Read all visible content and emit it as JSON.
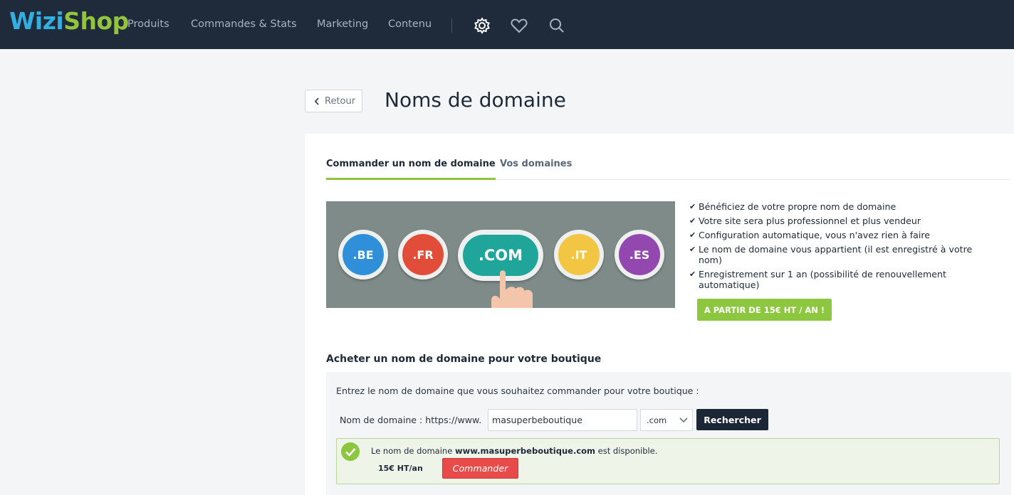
{
  "brand": {
    "part1": "Wizi",
    "part2": "Shop"
  },
  "nav": {
    "items": [
      "Produits",
      "Commandes & Stats",
      "Marketing",
      "Contenu"
    ],
    "icons": [
      "gear-icon",
      "heart-icon",
      "search-icon"
    ]
  },
  "header": {
    "back_label": "Retour",
    "title": "Noms de domaine"
  },
  "tabs": [
    {
      "label": "Commander un nom de domaine",
      "active": true
    },
    {
      "label": "Vos domaines",
      "active": false
    }
  ],
  "banner": {
    "extensions": [
      {
        "label": ".BE",
        "color": "#2f8fd8"
      },
      {
        "label": ".FR",
        "color": "#e24d3a"
      },
      {
        "label": ".COM",
        "color": "#1fa59a"
      },
      {
        "label": ".IT",
        "color": "#f2c542"
      },
      {
        "label": ".ES",
        "color": "#9348b0"
      }
    ]
  },
  "features": [
    "Bénéficiez de votre propre nom de domaine",
    "Votre site sera plus professionnel et plus vendeur",
    "Configuration automatique, vous n'avez rien à faire",
    "Le nom de domaine vous appartient (il est enregistré à votre nom)",
    "Enregistrement sur 1 an (possibilité de renouvellement automatique)"
  ],
  "cta_label": "A PARTIR DE 15€ HT / AN !",
  "buy": {
    "section_title": "Acheter un nom de domaine pour votre boutique",
    "intro": "Entrez le nom de domaine que vous souhaitez commander pour votre boutique :",
    "field_label": "Nom de domaine : https://www.",
    "domain_value": "masuperbeboutique",
    "extension_selected": ".com",
    "search_label": "Rechercher"
  },
  "result": {
    "prefix": "Le nom de domaine ",
    "domain": "www.masuperbeboutique.com",
    "suffix": " est disponible.",
    "price": "15€ HT/an",
    "order_label": "Commander"
  },
  "colors": {
    "nav_bg": "#1f2a3b",
    "accent_green": "#8dc63f",
    "brand_blue": "#34aee0",
    "order_red": "#e94b4b"
  }
}
